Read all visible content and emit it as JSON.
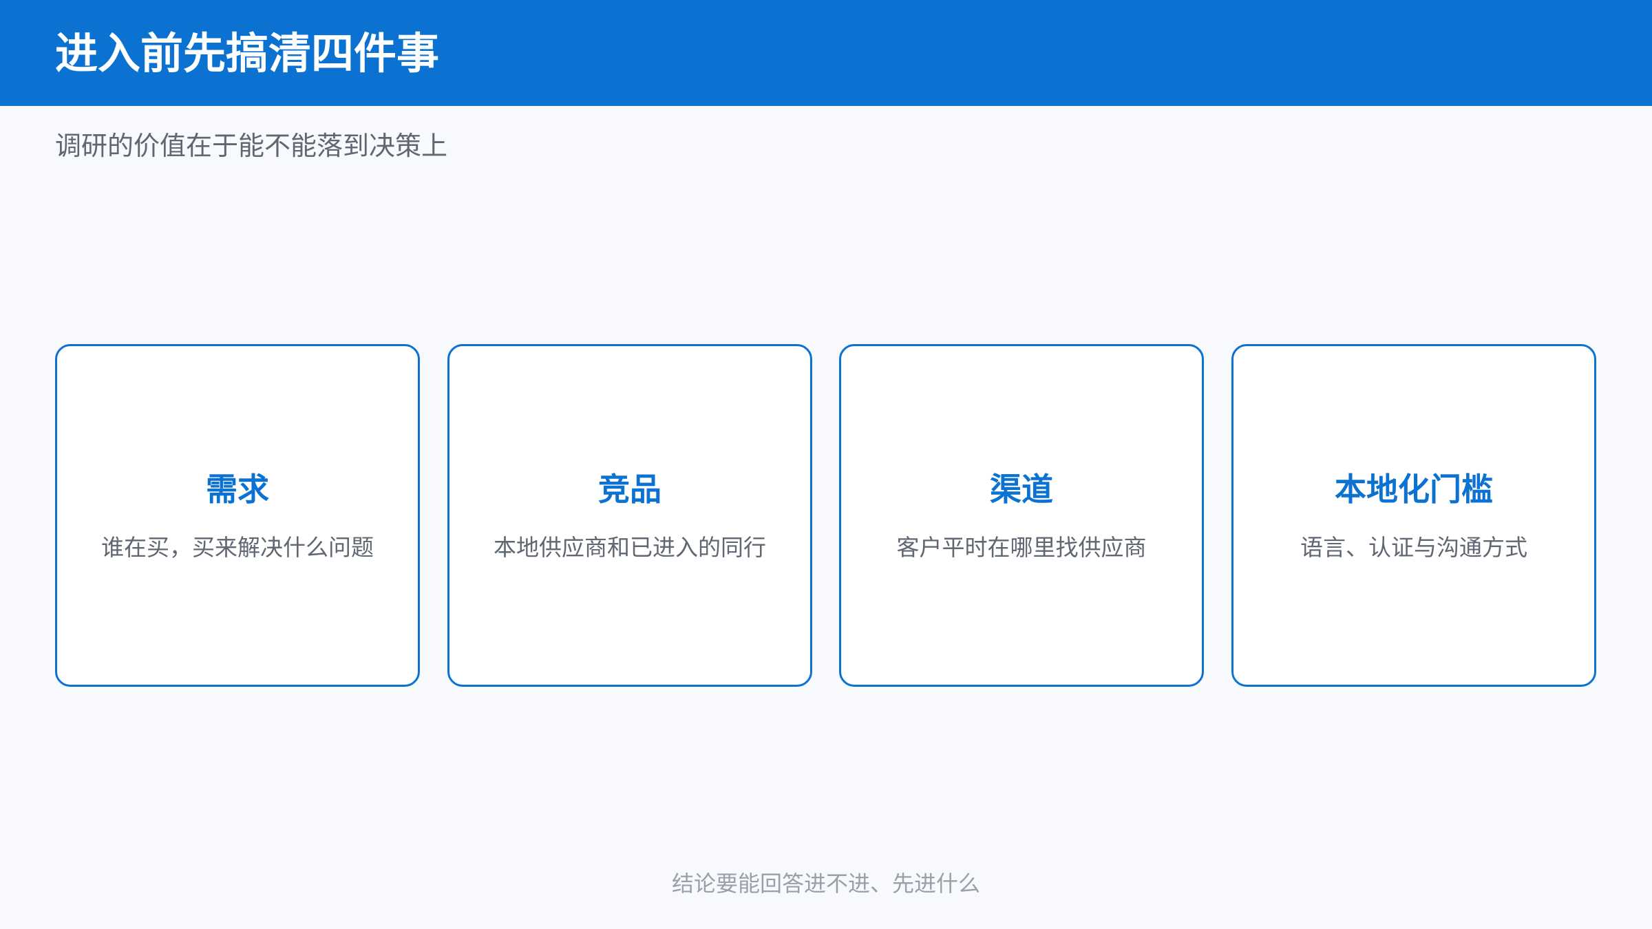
{
  "header": {
    "title": "进入前先搞清四件事",
    "background_color": "#0b72d2"
  },
  "subtitle": "调研的价值在于能不能落到决策上",
  "cards": [
    {
      "title": "需求",
      "description": "谁在买，买来解决什么问题"
    },
    {
      "title": "竞品",
      "description": "本地供应商和已进入的同行"
    },
    {
      "title": "渠道",
      "description": "客户平时在哪里找供应商"
    },
    {
      "title": "本地化门槛",
      "description": "语言、认证与沟通方式"
    }
  ],
  "footer_note": "结论要能回答进不进、先进什么",
  "colors": {
    "accent": "#0b72d2",
    "background": "#f7f9fc",
    "text_secondary": "#5f6772",
    "text_muted": "#98a0aa"
  }
}
